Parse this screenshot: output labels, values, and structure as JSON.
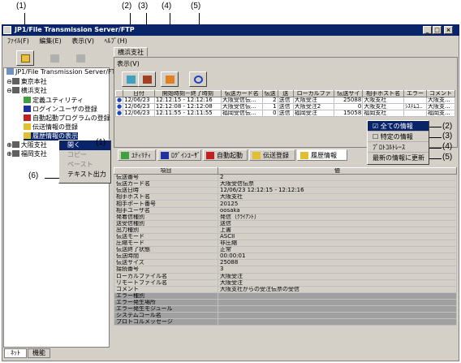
{
  "window": {
    "title": "JP1/File Transmission Server/FTP"
  },
  "menu": [
    "ﾌｧｲﾙ(F)",
    "編集(E)",
    "表示(V)",
    "ﾍﾙﾌﾟ(H)"
  ],
  "callouts": {
    "c1": "(1)",
    "c2": "(2)",
    "c3": "(3)",
    "c4": "(4)",
    "c5": "(5)",
    "c6": "(6)",
    "r1": "(1)",
    "r2": "(2)",
    "r3": "(3)",
    "r4": "(4)",
    "r5": "(5)"
  },
  "tree": {
    "root": "JP1/File Transmission Server/FTP",
    "n1": "東京本社",
    "n2": "横浜支社",
    "n3": "定義ユティリティ",
    "n4": "ログインユーザの登録",
    "n5": "自動起動プログラムの登録",
    "n6": "伝送情報の登録",
    "n7": "履歴情報の表示",
    "n8": "大阪支社",
    "n9": "福岡支社"
  },
  "context_menu": {
    "open": "開く",
    "copy": "コピー",
    "paste": "ペースト",
    "text_out": "テキスト出力"
  },
  "left_tabs": {
    "net": "ﾈｯﾄ",
    "func": "機能"
  },
  "right": {
    "tab": "横浜支社",
    "view_label": "表示(V)"
  },
  "log": {
    "headers": [
      "",
      "日付",
      "開始時刻－終了時刻",
      "伝送カード名",
      "伝送",
      "送",
      "ローカルファ",
      "伝送サイ",
      "相手ホスト名",
      "エラー",
      "コメント"
    ],
    "rows": [
      [
        "",
        "12/06/23",
        "12:12:15 - 12:12:16",
        "大阪受信伝...",
        "2",
        "送信",
        "大阪受注",
        "25088",
        "大阪支社",
        "",
        "大阪支..."
      ],
      [
        "",
        "12/06/23",
        "12:12:08 - 12:12:08",
        "大阪受信伝...",
        "1",
        "送信",
        "大阪受注2",
        "0",
        "大阪支社",
        "ｼｽﾃﾑｺ..",
        "大阪支..."
      ],
      [
        "",
        "12/06/23",
        "12:11:55 - 12:11:55",
        "福岡受信伝...",
        "0",
        "送信",
        "福岡受注",
        "15058",
        "福岡支社",
        "",
        "福岡支..."
      ]
    ]
  },
  "popup": {
    "all": "全ての情報",
    "specific": "特定の情報",
    "protocol": "ﾌﾟﾛﾄｺﾙﾄﾚｰｽ",
    "refresh": "最新の情報に更新"
  },
  "subtabs": [
    "ﾕﾃｨﾘﾃｨ",
    "ﾛｸﾞｲﾝﾕｰｻﾞ",
    "自動起動",
    "伝送登録",
    "履歴情報"
  ],
  "props": {
    "headers": [
      "項目",
      "値"
    ],
    "rows": [
      [
        "伝送番号",
        "2"
      ],
      [
        "伝送カード名",
        "大阪受信伝票"
      ],
      [
        "伝送日時",
        "12/06/23 12:12:15 - 12:12:16"
      ],
      [
        "相手ホスト名",
        "大阪支社"
      ],
      [
        "相手ポート番号",
        "20125"
      ],
      [
        "相手ユーザ名",
        "oosaka"
      ],
      [
        "発着信種別",
        "発信（ｸﾗｲｱﾝﾄ）"
      ],
      [
        "送受信種別",
        "送信"
      ],
      [
        "出力種別",
        "上書"
      ],
      [
        "伝送モード",
        "ASCII"
      ],
      [
        "圧縮モード",
        "非圧縮"
      ],
      [
        "伝送終了状態",
        "正常"
      ],
      [
        "伝送時間",
        "00:00:01"
      ],
      [
        "伝送サイズ",
        "25088"
      ],
      [
        "接続番号",
        "3"
      ],
      [
        "ローカルファイル名",
        "大阪受注"
      ],
      [
        "リモートファイル名",
        "大阪受注"
      ],
      [
        "コメント",
        "大阪支社からの受注伝票の受信"
      ],
      [
        "エラー種別",
        ""
      ],
      [
        "エラー発生場所",
        ""
      ],
      [
        "エラー発生モジュール",
        ""
      ],
      [
        "システムコール名",
        ""
      ],
      [
        "プロトコルメッセージ",
        ""
      ]
    ]
  }
}
